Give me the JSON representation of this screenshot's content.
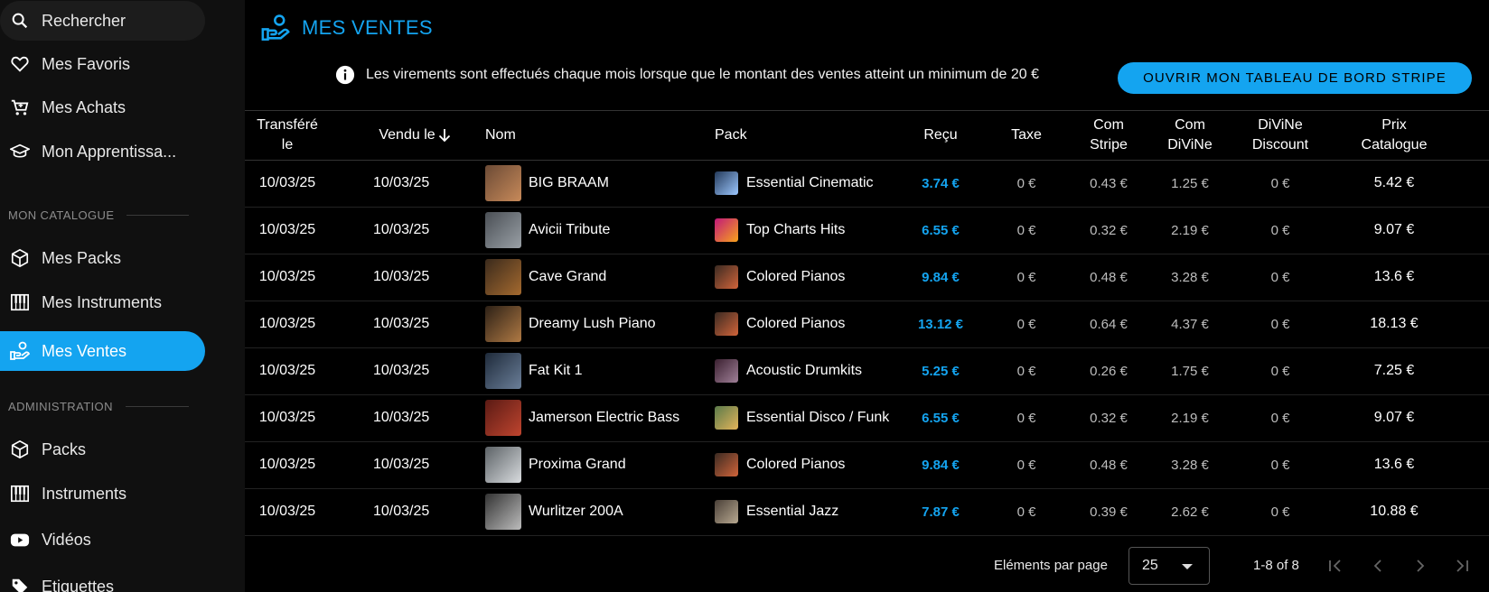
{
  "sidebar": {
    "search_label": "Rechercher",
    "favorites_label": "Mes Favoris",
    "purchases_label": "Mes Achats",
    "learning_label": "Mon Apprentissa...",
    "catalog_section": "MON CATALOGUE",
    "packs_label": "Mes Packs",
    "instruments_label": "Mes Instruments",
    "sales_label": "Mes Ventes",
    "admin_section": "ADMINISTRATION",
    "admin_packs_label": "Packs",
    "admin_instruments_label": "Instruments",
    "admin_videos_label": "Vidéos",
    "admin_labels_label": "Etiquettes"
  },
  "page": {
    "title": "MES VENTES",
    "info_text": "Les virements sont effectués chaque mois lorsque que le montant des ventes atteint un minimum de 20 €",
    "stripe_button": "OUVRIR MON TABLEAU DE BORD STRIPE"
  },
  "table": {
    "headers": {
      "transferred": "Transféré le",
      "sold": "Vendu le",
      "name": "Nom",
      "pack": "Pack",
      "received": "Reçu",
      "tax": "Taxe",
      "com_stripe": "Com Stripe",
      "com_divine": "Com DiViNe",
      "divine_discount": "DiViNe Discount",
      "catalog_price": "Prix Catalogue"
    },
    "rows": [
      {
        "transferred": "10/03/25",
        "sold": "10/03/25",
        "name": "BIG BRAAM",
        "pack": "Essential Cinematic",
        "received": "3.74 €",
        "tax": "0 €",
        "com_stripe": "0.43 €",
        "com_divine": "1.25 €",
        "discount": "0 €",
        "price": "5.42 €"
      },
      {
        "transferred": "10/03/25",
        "sold": "10/03/25",
        "name": "Avicii Tribute",
        "pack": "Top Charts Hits",
        "received": "6.55 €",
        "tax": "0 €",
        "com_stripe": "0.32 €",
        "com_divine": "2.19 €",
        "discount": "0 €",
        "price": "9.07 €"
      },
      {
        "transferred": "10/03/25",
        "sold": "10/03/25",
        "name": "Cave Grand",
        "pack": "Colored Pianos",
        "received": "9.84 €",
        "tax": "0 €",
        "com_stripe": "0.48 €",
        "com_divine": "3.28 €",
        "discount": "0 €",
        "price": "13.6 €"
      },
      {
        "transferred": "10/03/25",
        "sold": "10/03/25",
        "name": "Dreamy Lush Piano",
        "pack": "Colored Pianos",
        "received": "13.12 €",
        "tax": "0 €",
        "com_stripe": "0.64 €",
        "com_divine": "4.37 €",
        "discount": "0 €",
        "price": "18.13 €"
      },
      {
        "transferred": "10/03/25",
        "sold": "10/03/25",
        "name": "Fat Kit 1",
        "pack": "Acoustic Drumkits",
        "received": "5.25 €",
        "tax": "0 €",
        "com_stripe": "0.26 €",
        "com_divine": "1.75 €",
        "discount": "0 €",
        "price": "7.25 €"
      },
      {
        "transferred": "10/03/25",
        "sold": "10/03/25",
        "name": "Jamerson Electric Bass",
        "pack": "Essential Disco / Funk",
        "received": "6.55 €",
        "tax": "0 €",
        "com_stripe": "0.32 €",
        "com_divine": "2.19 €",
        "discount": "0 €",
        "price": "9.07 €"
      },
      {
        "transferred": "10/03/25",
        "sold": "10/03/25",
        "name": "Proxima Grand",
        "pack": "Colored Pianos",
        "received": "9.84 €",
        "tax": "0 €",
        "com_stripe": "0.48 €",
        "com_divine": "3.28 €",
        "discount": "0 €",
        "price": "13.6 €"
      },
      {
        "transferred": "10/03/25",
        "sold": "10/03/25",
        "name": "Wurlitzer 200A",
        "pack": "Essential Jazz",
        "received": "7.87 €",
        "tax": "0 €",
        "com_stripe": "0.39 €",
        "com_divine": "2.62 €",
        "discount": "0 €",
        "price": "10.88 €"
      }
    ]
  },
  "pager": {
    "per_page_label": "Eléments par page",
    "per_page_value": "25",
    "range_text": "1-8 of 8"
  },
  "colors": {
    "accent": "#14a4f0",
    "background": "#000000",
    "sidebar": "#101010"
  },
  "icons": [
    "search-icon",
    "heart-icon",
    "cart-icon",
    "graduation-icon",
    "cube-icon",
    "piano-icon",
    "sales-hand-icon",
    "play-icon",
    "tag-icon",
    "info-icon",
    "arrow-down-icon",
    "first-page-icon",
    "prev-page-icon",
    "next-page-icon",
    "last-page-icon"
  ]
}
